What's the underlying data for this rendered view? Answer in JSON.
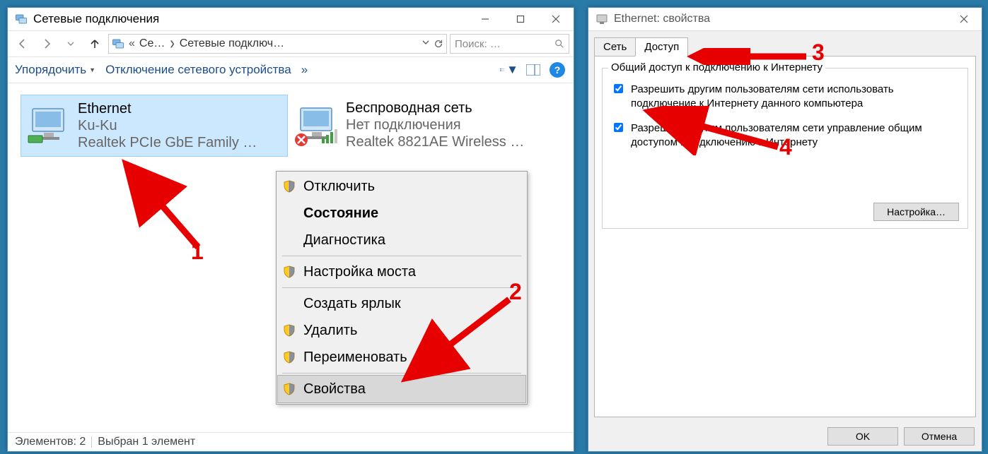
{
  "explorer": {
    "title": "Сетевые подключения",
    "breadcrumb": {
      "root": "Се…",
      "current": "Сетевые подключ…"
    },
    "search_placeholder": "Поиск: …",
    "toolbar": {
      "organize": "Упорядочить",
      "disable": "Отключение сетевого устройства",
      "more": "»"
    },
    "items": [
      {
        "name": "Ethernet",
        "status": "Ku-Ku",
        "device": "Realtek PCIe GbE Family …"
      },
      {
        "name": "Беспроводная сеть",
        "status": "Нет подключения",
        "device": "Realtek 8821AE Wireless …"
      }
    ],
    "statusbar": {
      "count_label": "Элементов: 2",
      "selection_label": "Выбран 1 элемент"
    }
  },
  "context_menu": {
    "disable": "Отключить",
    "status": "Состояние",
    "diagnose": "Диагностика",
    "bridge": "Настройка моста",
    "shortcut": "Создать ярлык",
    "delete": "Удалить",
    "rename": "Переименовать",
    "properties": "Свойства"
  },
  "dialog": {
    "title": "Ethernet: свойства",
    "tabs": {
      "network": "Сеть",
      "sharing": "Доступ"
    },
    "group_legend": "Общий доступ к подключению к Интернету",
    "check1": "Разрешить другим пользователям сети использовать подключение к Интернету данного компьютера",
    "check2": "Разрешить другим пользователям сети управление общим доступом к подключению к Интернету",
    "settings_btn": "Настройка…",
    "ok": "OK",
    "cancel": "Отмена"
  },
  "annotations": {
    "n1": "1",
    "n2": "2",
    "n3": "3",
    "n4": "4"
  }
}
